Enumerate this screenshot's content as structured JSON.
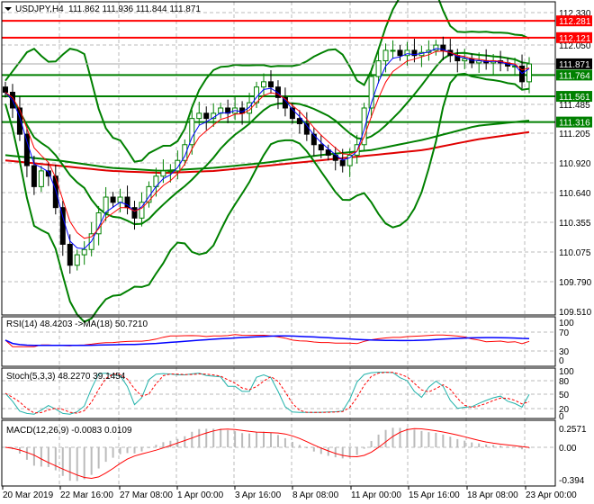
{
  "header": {
    "symbol": "USDJPY,H4",
    "ohlc": "111.862 111.936 111.844 111.871"
  },
  "price_axis": [
    "112.330",
    "112.050",
    "111.485",
    "111.205",
    "110.920",
    "110.640",
    "110.355",
    "110.075",
    "109.790",
    "109.510"
  ],
  "levels": [
    {
      "price": 112.281,
      "label": "112.281",
      "color": "#ff0000"
    },
    {
      "price": 112.121,
      "label": "112.121",
      "color": "#ff0000"
    },
    {
      "price": 111.764,
      "label": "111.764",
      "color": "#008000"
    },
    {
      "price": 111.561,
      "label": "111.561",
      "color": "#008000"
    },
    {
      "price": 111.316,
      "label": "111.316",
      "color": "#008000"
    }
  ],
  "current_price": {
    "price": 111.871,
    "label": "111.871",
    "color": "#000000"
  },
  "rsi": {
    "title": "RSI(14) 48.4203  ->MA(18) 50.7210",
    "axis": [
      "100",
      "70",
      "30",
      "0"
    ]
  },
  "stoch": {
    "title": "Stoch(5,3,3) 48.2270 39.1454",
    "axis": [
      "100",
      "80",
      "50",
      "20",
      "0"
    ]
  },
  "macd": {
    "title": "MACD(12,26,9) -0.0083 0.0109",
    "axis": [
      "0.2571",
      "0.00",
      "-0.394"
    ]
  },
  "time_axis": [
    "20 Mar 2019",
    "22 Mar 16:00",
    "27 Mar 08:00",
    "1 Apr 00:00",
    "3 Apr 16:00",
    "8 Apr 08:00",
    "11 Apr 00:00",
    "15 Apr 16:00",
    "18 Apr 08:00",
    "23 Apr 00:00"
  ],
  "chart_data": {
    "type": "candlestick",
    "title": "USDJPY,H4",
    "ylim": [
      109.51,
      112.33
    ],
    "closes": [
      111.6,
      111.45,
      111.2,
      110.9,
      110.7,
      110.85,
      110.8,
      110.5,
      110.15,
      109.95,
      110.05,
      110.1,
      110.25,
      110.45,
      110.6,
      110.55,
      110.6,
      110.5,
      110.4,
      110.55,
      110.7,
      110.8,
      110.85,
      110.85,
      110.95,
      111.1,
      111.35,
      111.4,
      111.35,
      111.4,
      111.45,
      111.4,
      111.45,
      111.4,
      111.5,
      111.65,
      111.7,
      111.65,
      111.55,
      111.45,
      111.35,
      111.3,
      111.2,
      111.1,
      111.05,
      111.0,
      110.95,
      110.9,
      111.0,
      111.1,
      111.45,
      111.75,
      111.9,
      112.0,
      112.0,
      111.95,
      112.0,
      111.95,
      111.98,
      112.0,
      112.05,
      112.0,
      111.95,
      111.9,
      111.92,
      111.88,
      111.9,
      111.88,
      111.9,
      111.88,
      111.85,
      111.85,
      111.7,
      111.87
    ],
    "long_ma_red": [
      110.95,
      110.9,
      110.85,
      110.83,
      110.85,
      110.9,
      110.95,
      111.0,
      111.05,
      111.15,
      111.22
    ],
    "long_ma_green": [
      111.0,
      110.95,
      110.88,
      110.85,
      110.88,
      110.93,
      111.0,
      111.05,
      111.15,
      111.28,
      111.33
    ],
    "colors": {
      "bull": "#008000",
      "bear": "#000000",
      "ma_fast": "#0000ff",
      "ma_slow": "#ff0000",
      "bands": "#008000"
    }
  }
}
